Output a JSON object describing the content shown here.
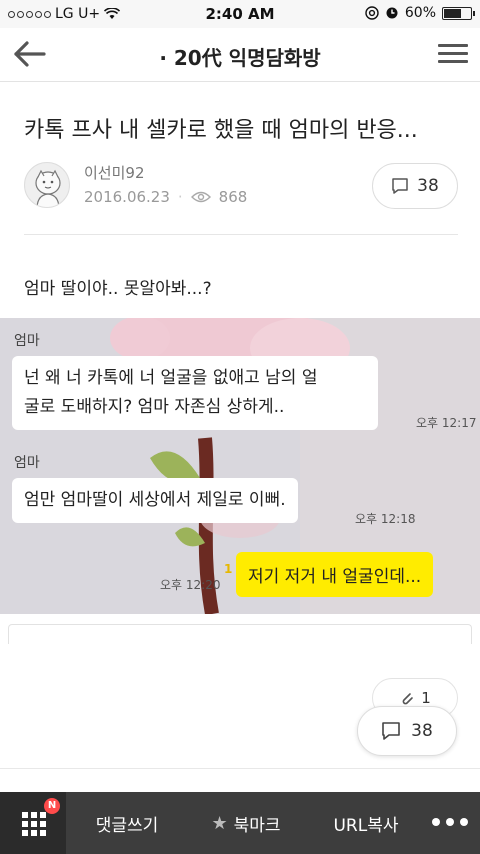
{
  "status_bar": {
    "carrier": "LG U+",
    "time": "2:40 AM",
    "battery": "60%",
    "battery_level": 0.6
  },
  "nav": {
    "title": "· 20代 익명담화방",
    "back_icon": "arrow-left-icon",
    "menu_icon": "hamburger-menu-icon"
  },
  "post": {
    "title": "카톡 프사 내 셀카로 했을 때 엄마의 반응...",
    "author": "이선미92",
    "date": "2016.06.23",
    "views": "868",
    "comment_count": "38",
    "body": "엄마 딸이야.. 못알아봐...?"
  },
  "chat": {
    "messages": [
      {
        "sender": "엄마",
        "text_line1": "넌 왜 너 카톡에 너 얼굴을 없애고 남의 얼",
        "text_line2": "굴로 도배하지? 엄마 자존심 상하게..",
        "time": "오후 12:17"
      },
      {
        "sender": "엄마",
        "text": "엄만 엄마딸이 세상에서 제일로 이뻐.",
        "time": "오후 12:18"
      },
      {
        "text": "저기 저거 내 얼굴인데...",
        "time": "오후 12:20",
        "unread": "1"
      }
    ]
  },
  "actions": {
    "like_count": "1",
    "comments_count": "38"
  },
  "toolbar": {
    "badge": "N",
    "write_comment": "댓글쓰기",
    "bookmark": "북마크",
    "copy_url": "URL복사"
  },
  "colors": {
    "toolbar_bg": "#3d3d3d",
    "yellow_bubble": "#ffec00",
    "badge": "#ff4b4b"
  }
}
